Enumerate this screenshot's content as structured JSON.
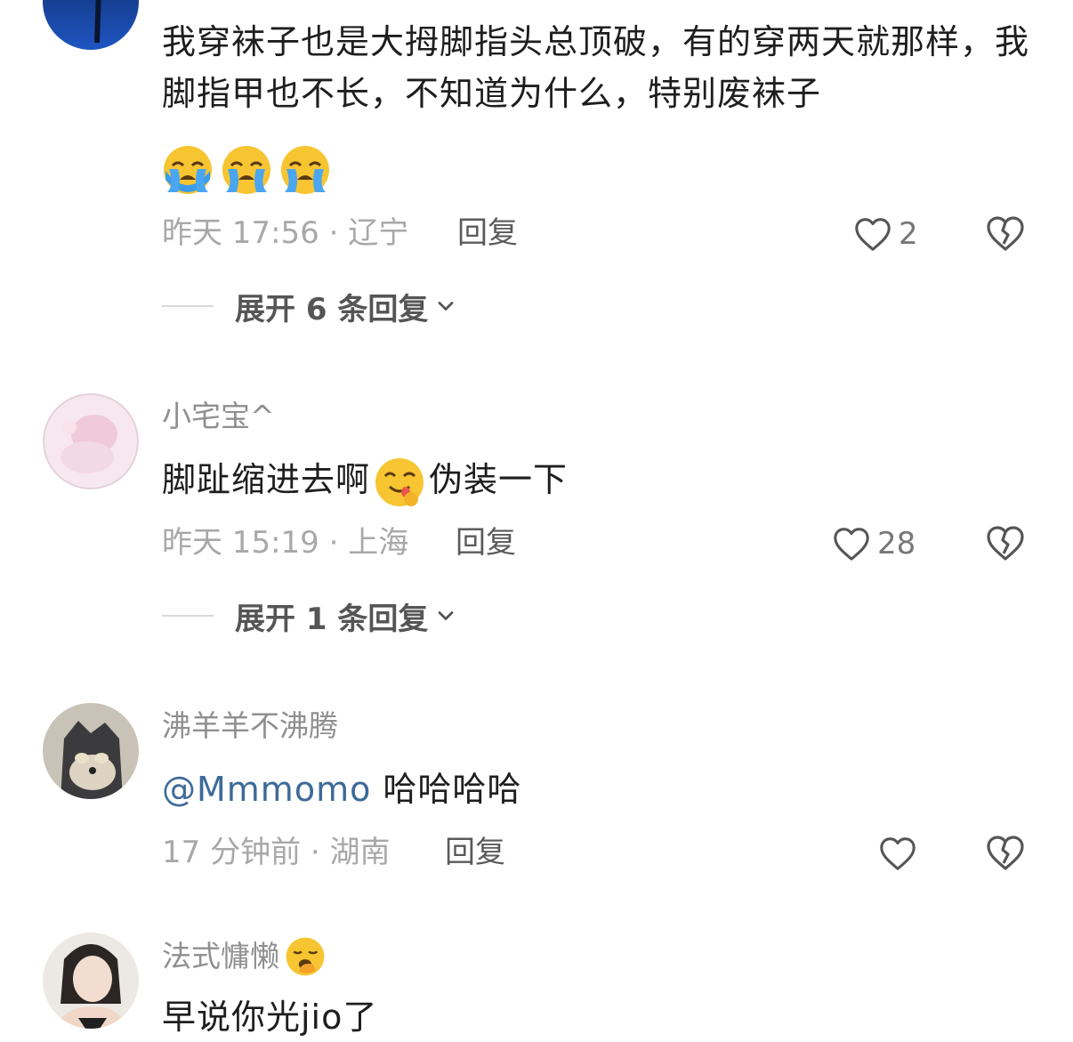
{
  "comments": [
    {
      "text": "我穿袜子也是大拇脚指头总顶破，有的穿两天就那样，我脚指甲也不长，不知道为什么，特别废袜子",
      "emojis": [
        "crying-face",
        "crying-face",
        "crying-face"
      ],
      "meta": "昨天 17:56 · 辽宁",
      "reply_label": "回复",
      "likes": "2",
      "expand_label": "展开 6 条回复"
    },
    {
      "username": "小宅宝^",
      "text_before": "脚趾缩进去啊",
      "emoji": "yum-face",
      "text_after": "伪装一下",
      "meta": "昨天 15:19 · 上海",
      "reply_label": "回复",
      "likes": "28",
      "expand_label": "展开 1 条回复"
    },
    {
      "username": "沸羊羊不沸腾",
      "mention": "@Mmmomo",
      "text": " 哈哈哈哈",
      "meta": "17 分钟前 · 湖南",
      "reply_label": "回复",
      "likes": ""
    },
    {
      "username": "法式慵懒",
      "username_emoji": "yawning-face",
      "text": "早说你光jio了"
    }
  ],
  "colors": {
    "username": "#8f8f8f",
    "meta": "#a8a8a8",
    "mention": "#3d6a99",
    "text": "#1e1e1e"
  },
  "icons": [
    "heart-outline-icon",
    "broken-heart-icon",
    "chevron-down-icon"
  ]
}
